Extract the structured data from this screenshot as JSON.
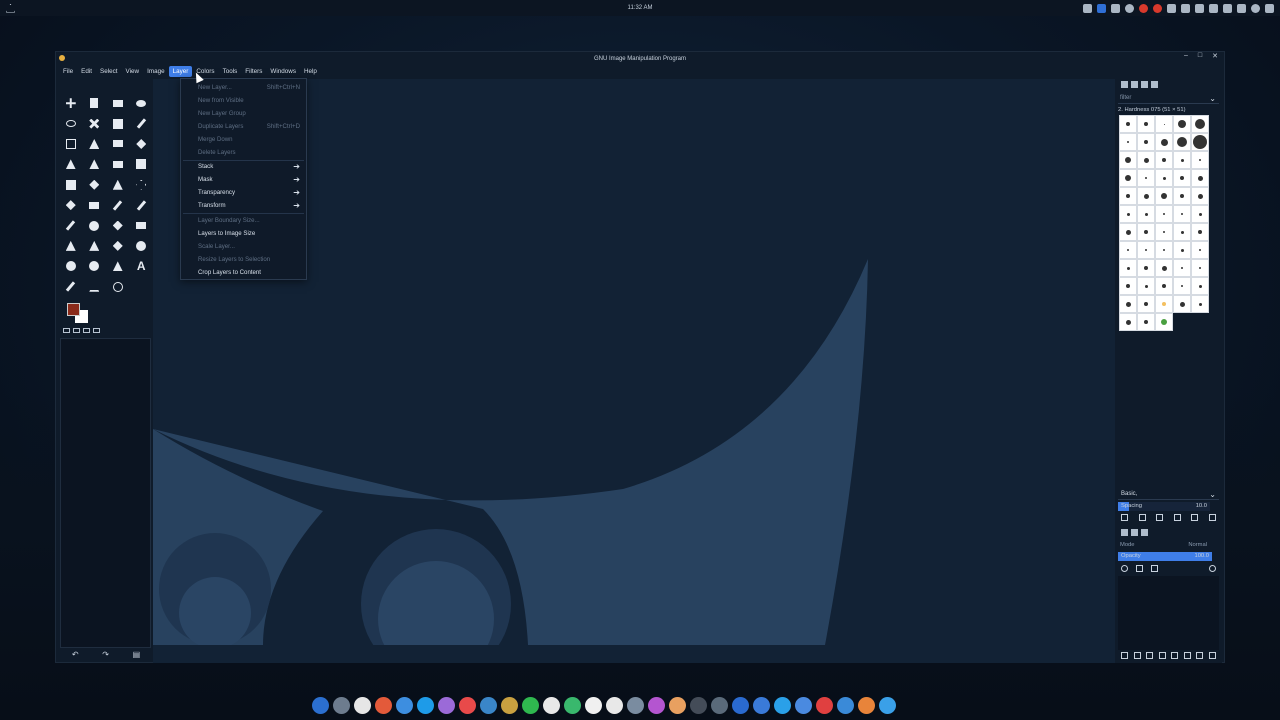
{
  "topbar": {
    "clock": "11:32 AM"
  },
  "window": {
    "title": "GNU Image Manipulation Program"
  },
  "menubar": {
    "items": [
      "File",
      "Edit",
      "Select",
      "View",
      "Image",
      "Layer",
      "Colors",
      "Tools",
      "Filters",
      "Windows",
      "Help"
    ],
    "active": "Layer"
  },
  "layer_menu": {
    "items": [
      {
        "label": "New Layer...",
        "shortcut": "Shift+Ctrl+N",
        "enabled": false
      },
      {
        "label": "New from Visible",
        "shortcut": "",
        "enabled": false
      },
      {
        "label": "New Layer Group",
        "shortcut": "",
        "enabled": false
      },
      {
        "label": "Duplicate Layers",
        "shortcut": "Shift+Ctrl+D",
        "enabled": false
      },
      {
        "label": "Merge Down",
        "shortcut": "",
        "enabled": false
      },
      {
        "label": "Delete Layers",
        "shortcut": "",
        "enabled": false
      },
      {
        "label": "Stack",
        "submenu": true,
        "enabled": true
      },
      {
        "label": "Mask",
        "submenu": true,
        "enabled": true
      },
      {
        "label": "Transparency",
        "submenu": true,
        "enabled": true
      },
      {
        "label": "Transform",
        "submenu": true,
        "enabled": true
      },
      {
        "label": "Layer Boundary Size...",
        "enabled": false
      },
      {
        "label": "Layers to Image Size",
        "enabled": true
      },
      {
        "label": "Scale Layer...",
        "enabled": false
      },
      {
        "label": "Resize Layers to Selection",
        "enabled": false
      },
      {
        "label": "Crop Layers to Content",
        "enabled": true
      }
    ]
  },
  "brushes": {
    "filter_placeholder": "filter",
    "current_brush": "2. Hardness 075 (51 × 51)",
    "preset": "Basic,",
    "spacing_label": "Spacing",
    "spacing_value": "10.0"
  },
  "layers": {
    "mode_label": "Mode",
    "mode_value": "Normal",
    "opacity_label": "Opacity",
    "opacity_value": "100.0"
  },
  "colors": {
    "foreground": "#8a2a1a",
    "background": "#ffffff",
    "accent": "#3f7ee8"
  },
  "dock_apps": [
    "#2b6fd0",
    "#6d7c8e",
    "#e6e6e6",
    "#e35a3a",
    "#3d8ee0",
    "#1e9be8",
    "#9b6ad8",
    "#e84a4a",
    "#3a86c8",
    "#c8a040",
    "#2fb84f",
    "#e8e8e8",
    "#39b86d",
    "#f0f0f0",
    "#e8e8e8",
    "#7a8ca0",
    "#b455d0",
    "#e8a060",
    "#444c58",
    "#5a6a7a",
    "#2a6ad0",
    "#3a7ad8",
    "#2aa0e8",
    "#4a8ae0",
    "#e04040",
    "#3a8ad8",
    "#e8843a",
    "#3aa0e8"
  ]
}
